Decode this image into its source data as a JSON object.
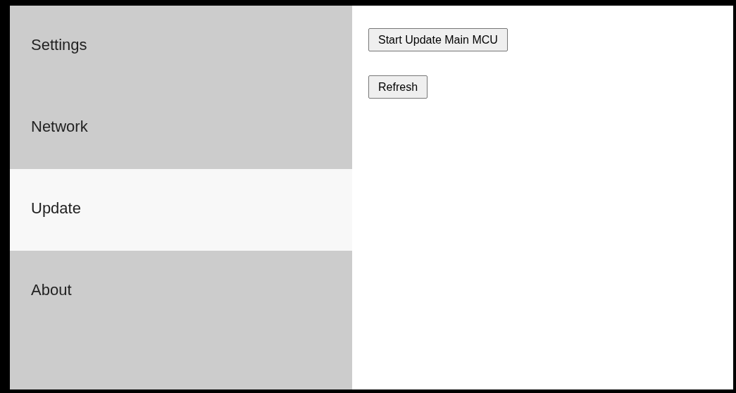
{
  "sidebar": {
    "items": [
      {
        "label": "Settings",
        "selected": false
      },
      {
        "label": "Network",
        "selected": false
      },
      {
        "label": "Update",
        "selected": true
      },
      {
        "label": "About",
        "selected": false
      }
    ]
  },
  "buttons": [
    "Start Update Main MCU",
    "Refresh"
  ]
}
